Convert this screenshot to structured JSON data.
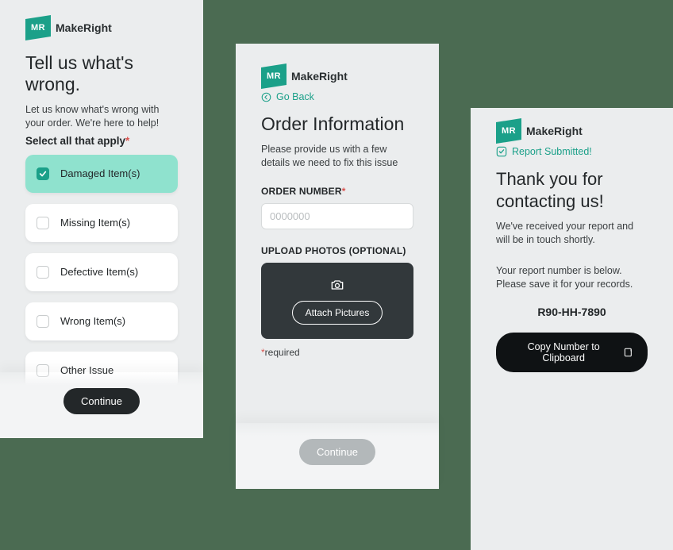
{
  "brand": {
    "badge": "MR",
    "name": "MakeRight"
  },
  "panel1": {
    "title": "Tell us what's wrong.",
    "subtitle": "Let us know what's wrong with your order. We're here to help!",
    "select_label": "Select all that apply",
    "options": [
      {
        "label": "Damaged Item(s)",
        "selected": true
      },
      {
        "label": "Missing Item(s)",
        "selected": false
      },
      {
        "label": "Defective Item(s)",
        "selected": false
      },
      {
        "label": "Wrong Item(s)",
        "selected": false
      },
      {
        "label": "Other Issue",
        "selected": false
      }
    ],
    "continue_label": "Continue"
  },
  "panel2": {
    "go_back_label": "Go Back",
    "title": "Order Information",
    "subtitle": "Please provide us with a few details we need to fix this issue",
    "order_number_label": "ORDER NUMBER",
    "order_number_placeholder": "0000000",
    "upload_label": "UPLOAD PHOTOS (OPTIONAL)",
    "attach_label": "Attach Pictures",
    "required_note": "required",
    "continue_label": "Continue"
  },
  "panel3": {
    "submitted_label": "Report Submitted!",
    "title": "Thank you for contacting us!",
    "line1": "We've received your report and will be in touch shortly.",
    "line2": "Your report number is below. Please save it for your records.",
    "report_number": "R90-HH-7890",
    "copy_label": "Copy Number to Clipboard"
  }
}
